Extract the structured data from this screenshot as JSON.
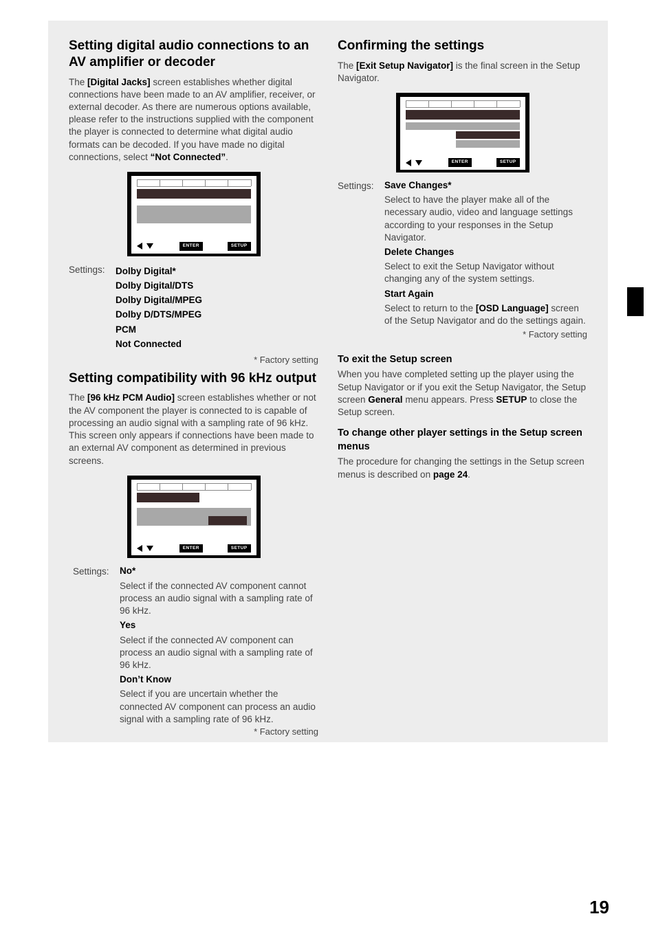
{
  "left": {
    "h2a": "Setting digital audio connections to an AV amplifier or decoder",
    "p1a": "The ",
    "p1b": "[Digital Jacks]",
    "p1c": " screen establishes whether digital connections have been made to an AV amplifier, receiver, or external decoder. As there are numerous options available, please refer to the instructions supplied with the component the player is connected to determine what digital audio formats can be decoded. If you have made no digital connections, select ",
    "p1d": "“Not Connected”",
    "p1e": ".",
    "settings_label": "Settings:",
    "opts1": [
      "Dolby Digital*",
      "Dolby Digital/DTS",
      "Dolby Digital/MPEG",
      "Dolby D/DTS/MPEG",
      "PCM",
      "Not Connected"
    ],
    "factory": "* Factory setting",
    "h2b": "Setting compatibility with 96 kHz output",
    "p2a": "The ",
    "p2b": "[96 kHz PCM Audio]",
    "p2c": " screen establishes whether or not the AV component the player is connected to is capable of processing an audio signal with a sampling rate of 96 kHz. This screen only appears if connections have been made to an external AV component as determined in previous screens.",
    "o2_no": "No*",
    "o2_no_d": "Select if the connected AV component cannot process an audio signal with a sampling rate of 96 kHz.",
    "o2_yes": "Yes",
    "o2_yes_d": "Select if the connected AV component can process an audio signal with a sampling rate of 96 kHz.",
    "o2_dk": "Don’t Know",
    "o2_dk_d": "Select if you are uncertain whether the connected AV component can process an audio signal with a sampling rate of 96 kHz."
  },
  "right": {
    "h2": "Confirming the settings",
    "p1a": "The ",
    "p1b": "[Exit Setup Navigator]",
    "p1c": " is the final screen in the Setup  Navigator.",
    "o_sc": "Save Changes*",
    "o_sc_d": "Select to have the player make all of the necessary audio, video and language settings according to your responses in the Setup Navigator.",
    "o_dc": "Delete Changes",
    "o_dc_d": "Select to exit the Setup Navigator without changing any of the system settings.",
    "o_sa": "Start Again",
    "o_sa_d1": "Select to return to the ",
    "o_sa_d2": "[OSD Language]",
    "o_sa_d3": " screen of the Setup Navigator and do the settings again.",
    "h3a": "To exit the Setup screen",
    "p_exit1": "When you have completed setting up the player using the Setup Navigator or if you exit the Setup Navigator, the Setup screen ",
    "p_exit2": "General",
    "p_exit3": " menu appears. Press ",
    "p_exit4": "SETUP",
    "p_exit5": " to close the Setup screen.",
    "h3b": "To change other player settings in the Setup screen menus",
    "p_ch1": "The procedure for changing the settings in the Setup screen menus is described on ",
    "p_ch2": "page 24",
    "p_ch3": "."
  },
  "btn": {
    "enter": "ENTER",
    "setup": "SETUP"
  },
  "pagenum": "19"
}
